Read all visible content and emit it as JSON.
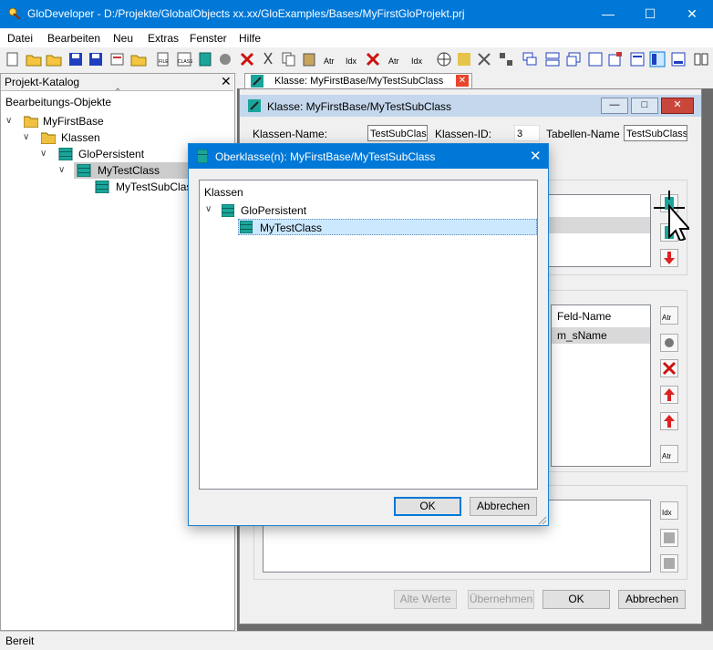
{
  "window": {
    "title": "GloDeveloper - D:/Projekte/GlobalObjects xx.xx/GloExamples/Bases/MyFirstGloProjekt.prj"
  },
  "menu": [
    "Datei",
    "Bearbeiten",
    "Neu",
    "Extras",
    "Fenster",
    "Hilfe"
  ],
  "catalog": {
    "header": "Projekt-Katalog",
    "section": "Bearbeitungs-Objekte",
    "tree": [
      "MyFirstBase",
      "Klassen",
      "GloPersistent",
      "MyTestClass",
      "MyTestSubClass"
    ]
  },
  "tab": {
    "label": "Klasse: MyFirstBase/MyTestSubClass"
  },
  "class_window": {
    "title": "Klasse: MyFirstBase/MyTestSubClass",
    "klassen_name_label": "Klassen-Name:",
    "klassen_name_value": "TestSubClass",
    "klassen_id_label": "Klassen-ID:",
    "klassen_id_value": "3",
    "tabellen_name_label": "Tabellen-Name :",
    "tabellen_name_value": "TestSubClass",
    "feld_name_header": "Feld-Name",
    "feld_row": "m_sName",
    "buttons": {
      "alte_werte": "Alte Werte",
      "uebernehmen": "Übernehmen",
      "ok": "OK",
      "abbrechen": "Abbrechen"
    }
  },
  "dialog": {
    "title": "Oberklasse(n): MyFirstBase/MyTestSubClass",
    "list_header": "Klassen",
    "items": [
      "GloPersistent",
      "MyTestClass"
    ],
    "ok": "OK",
    "cancel": "Abbrechen"
  },
  "status": {
    "text": "Bereit"
  },
  "colors": {
    "accent": "#0078d7",
    "selection": "#cce8ff",
    "teal_icon": "#1aa59a"
  }
}
